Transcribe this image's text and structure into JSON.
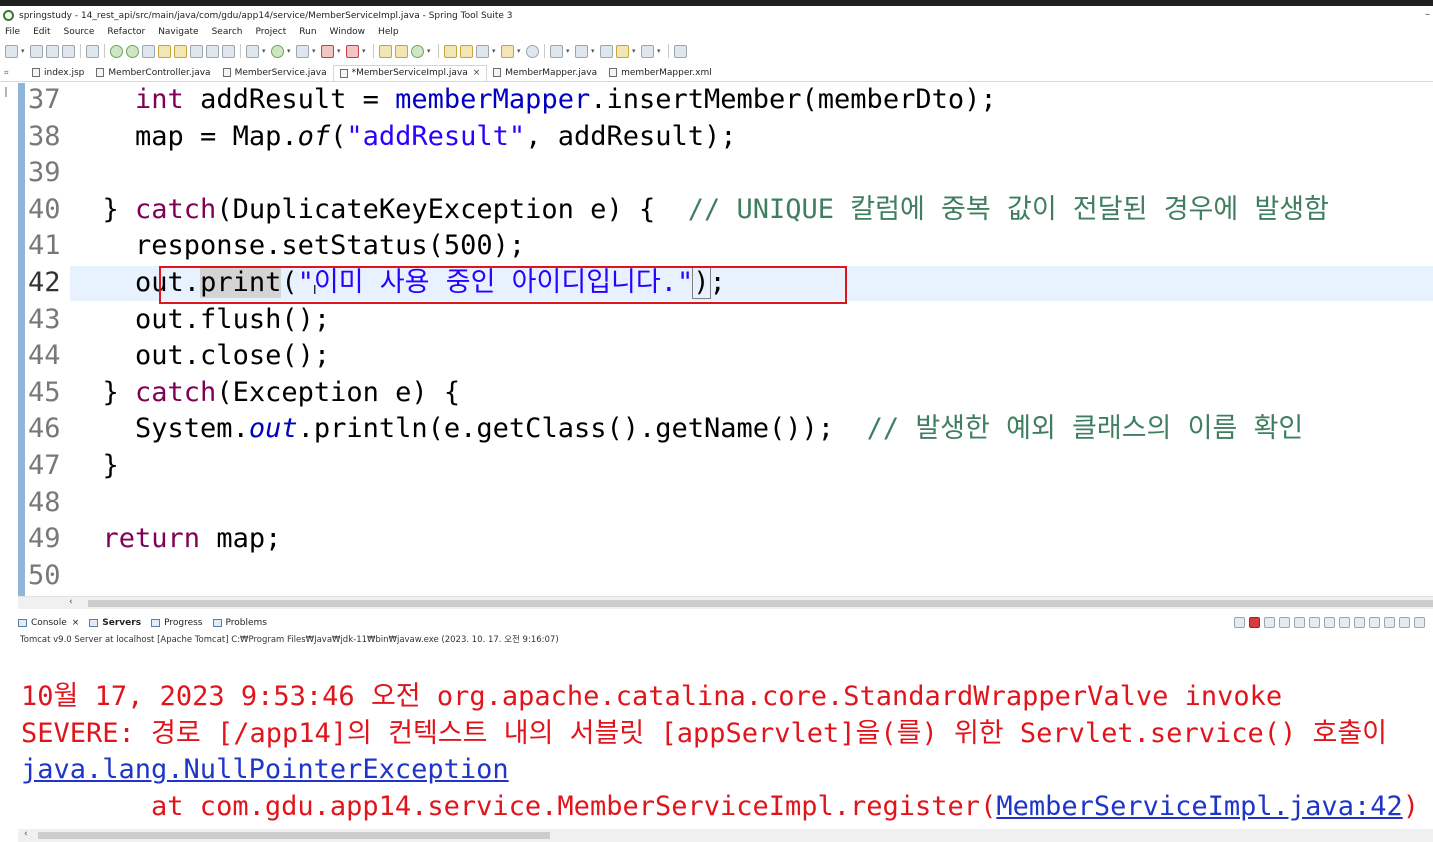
{
  "window": {
    "title": "springstudy - 14_rest_api/src/main/java/com/gdu/app14/service/MemberServiceImpl.java - Spring Tool Suite 3",
    "control_glyph": "–"
  },
  "menu": [
    "File",
    "Edit",
    "Source",
    "Refactor",
    "Navigate",
    "Search",
    "Project",
    "Run",
    "Window",
    "Help"
  ],
  "editor_tabs": [
    {
      "label": "index.jsp",
      "icon": "file-icon"
    },
    {
      "label": "MemberController.java",
      "icon": "java-file-icon"
    },
    {
      "label": "MemberService.java",
      "icon": "java-file-icon"
    },
    {
      "label": "*MemberServiceImpl.java",
      "icon": "java-file-icon",
      "active": true,
      "close": "×"
    },
    {
      "label": "MemberMapper.java",
      "icon": "java-file-icon"
    },
    {
      "label": "memberMapper.xml",
      "icon": "xml-file-icon"
    }
  ],
  "code": {
    "current_line": "42",
    "lines": [
      {
        "n": "37",
        "tokens": [
          [
            "sp",
            "    "
          ],
          [
            "kw",
            "int"
          ],
          [
            "",
            " addResult = "
          ],
          [
            "fld",
            "memberMapper"
          ],
          [
            "",
            ".insertMember(memberDto);"
          ]
        ]
      },
      {
        "n": "38",
        "tokens": [
          [
            "sp",
            "    "
          ],
          [
            "",
            "map = Map."
          ],
          [
            "stat",
            "of"
          ],
          [
            "",
            "("
          ],
          [
            "str",
            "\"addResult\""
          ],
          [
            "",
            ", addResult);"
          ]
        ]
      },
      {
        "n": "39",
        "tokens": []
      },
      {
        "n": "40",
        "tokens": [
          [
            "sp",
            "  "
          ],
          [
            "",
            "} "
          ],
          [
            "kw",
            "catch"
          ],
          [
            "",
            "(DuplicateKeyException e) {  "
          ],
          [
            "cmt",
            "// UNIQUE 칼럼에 중복 값이 전달된 경우에 발생함"
          ]
        ]
      },
      {
        "n": "41",
        "tokens": [
          [
            "sp",
            "    "
          ],
          [
            "",
            "response.setStatus(500);"
          ]
        ]
      },
      {
        "n": "42",
        "tokens": [
          [
            "sp",
            "    "
          ],
          [
            "",
            "out."
          ],
          [
            "occ",
            "print"
          ],
          [
            "",
            "("
          ],
          [
            "str",
            "\"이미 사용 중인 아이디입니다.\""
          ],
          [
            "bracket",
            ")"
          ],
          [
            "",
            ";"
          ]
        ]
      },
      {
        "n": "43",
        "tokens": [
          [
            "sp",
            "    "
          ],
          [
            "",
            "out.flush();"
          ]
        ]
      },
      {
        "n": "44",
        "tokens": [
          [
            "sp",
            "    "
          ],
          [
            "",
            "out.close();"
          ]
        ]
      },
      {
        "n": "45",
        "tokens": [
          [
            "sp",
            "  "
          ],
          [
            "",
            "} "
          ],
          [
            "kw",
            "catch"
          ],
          [
            "",
            "(Exception e) {"
          ]
        ]
      },
      {
        "n": "46",
        "tokens": [
          [
            "sp",
            "    "
          ],
          [
            "",
            "System."
          ],
          [
            "statfld",
            "out"
          ],
          [
            "",
            ".println(e.getClass().getName());  "
          ],
          [
            "cmt",
            "// 발생한 예외 클래스의 이름 확인"
          ]
        ]
      },
      {
        "n": "47",
        "tokens": [
          [
            "sp",
            "  "
          ],
          [
            "",
            "}"
          ]
        ]
      },
      {
        "n": "48",
        "tokens": []
      },
      {
        "n": "49",
        "tokens": [
          [
            "sp",
            "  "
          ],
          [
            "kw",
            "return"
          ],
          [
            "",
            " map;"
          ]
        ]
      },
      {
        "n": "50",
        "tokens": []
      }
    ]
  },
  "console_tabs": [
    {
      "label": "Console",
      "close": "×"
    },
    {
      "label": "Servers",
      "bold": true
    },
    {
      "label": "Progress"
    },
    {
      "label": "Problems"
    }
  ],
  "console": {
    "description": "Tomcat v9.0 Server at localhost [Apache Tomcat] C:₩Program Files₩Java₩jdk-11₩bin₩javaw.exe  (2023. 10. 17. 오전 9:16:07)",
    "lines": [
      {
        "text": "10월 17, 2023 9:53:46 오전 org.apache.catalina.core.StandardWrapperValve invoke"
      },
      {
        "text": "SEVERE: 경로 [/app14]의 컨텍스트 내의 서블릿 [appServlet]을(를) 위한 Servlet.service() 호출이"
      },
      {
        "link": "java.lang.NullPointerException"
      },
      {
        "text": "        at com.gdu.app14.service.MemberServiceImpl.register(",
        "link": "MemberServiceImpl.java:42",
        "after": ")"
      }
    ]
  },
  "scroll_arrow": "‹"
}
